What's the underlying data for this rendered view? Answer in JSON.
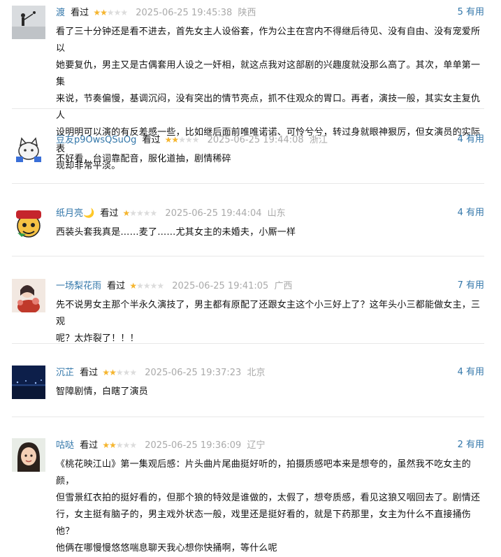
{
  "comments": [
    {
      "user": "渡",
      "status": "看过",
      "rating": 2,
      "time": "2025-06-25 19:45:38",
      "location": "陕西",
      "useful_count": "5",
      "useful_label": "有用",
      "lines": [
        "看了三十分钟还是看不进去，首先女主人设俗套，作为公主在宫内不得继后待见、没有自由、没有宠爱所以",
        "她要复仇，男主又是古偶套用人设之一奸相，就这点我对这部剧的兴趣度就没那么高了。其次，单单第一集",
        "来说，节奏偏慢，基调沉闷，没有突出的情节亮点，抓不住观众的胃口。再者，演技一般，其实女主复仇人",
        "设明明可以演的有反差感一些，比如继后面前唯唯诺诺、可怜兮兮，转过身就眼神狠厉，但女演员的实际表",
        "现却非常平淡。"
      ]
    },
    {
      "user": "豆友p9OwsQSuOg",
      "status": "看过",
      "rating": 2,
      "time": "2025-06-25 19:44:08",
      "location": "浙江",
      "useful_count": "4",
      "useful_label": "有用",
      "lines": [
        "不好看，台词靠配音，服化道抽，剧情稀碎"
      ]
    },
    {
      "user": "纸月亮🌙",
      "status": "看过",
      "rating": 1,
      "time": "2025-06-25 19:44:04",
      "location": "山东",
      "useful_count": "4",
      "useful_label": "有用",
      "lines": [
        "西装头套我真是……麦了……尤其女主的未婚夫，小厮一样"
      ]
    },
    {
      "user": "一场梨花雨",
      "status": "看过",
      "rating": 1,
      "time": "2025-06-25 19:41:05",
      "location": "广西",
      "useful_count": "7",
      "useful_label": "有用",
      "lines": [
        "先不说男女主那个半永久演技了，男主都有原配了还跟女主这个小三好上了？这年头小三都能做女主，三观",
        "呢？太炸裂了！！！"
      ]
    },
    {
      "user": "沉芷",
      "status": "看过",
      "rating": 2,
      "time": "2025-06-25 19:37:23",
      "location": "北京",
      "useful_count": "4",
      "useful_label": "有用",
      "lines": [
        "智障剧情，白瞎了演员"
      ]
    },
    {
      "user": "咕哒",
      "status": "看过",
      "rating": 2,
      "time": "2025-06-25 19:36:09",
      "location": "辽宁",
      "useful_count": "2",
      "useful_label": "有用",
      "lines": [
        "《桃花映江山》第一集观后感：片头曲片尾曲挺好听的，拍摄质感吧本来是想夸的，虽然我不吃女主的颜，",
        "但雪景红衣拍的挺好看的，但那个狼的特效是谁做的，太假了，想夸质感，看见这狼又咽回去了。剧情还",
        "行，女主挺有脑子的，男主戏外状态一般，戏里还是挺好看的，就是下药那里，女主为什么不直接捅伤他？",
        "他俩在哪慢慢悠悠喘息聊天我心想你快捅啊，等什么呢"
      ]
    }
  ]
}
